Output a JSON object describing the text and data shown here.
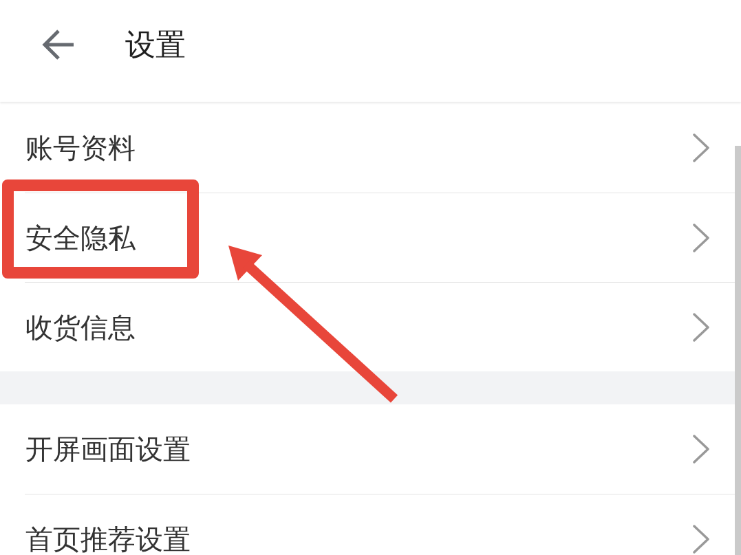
{
  "header": {
    "title": "设置"
  },
  "groups": [
    {
      "items": [
        {
          "label": "账号资料",
          "highlighted": false
        },
        {
          "label": "安全隐私",
          "highlighted": true
        },
        {
          "label": "收货信息",
          "highlighted": false
        }
      ]
    },
    {
      "items": [
        {
          "label": "开屏画面设置",
          "highlighted": false
        },
        {
          "label": "首页推荐设置",
          "highlighted": false
        }
      ]
    }
  ]
}
